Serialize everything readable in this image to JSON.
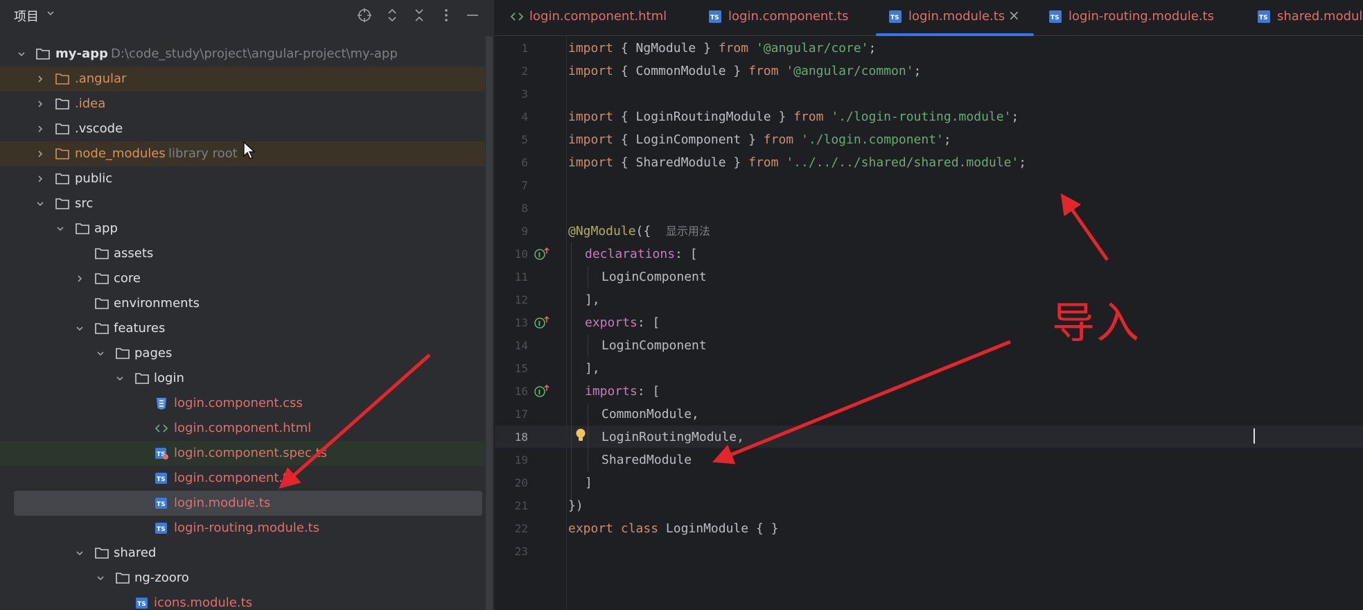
{
  "project": {
    "title": "项目",
    "header_icons": [
      "crosshair-icon",
      "expand-all-icon",
      "collapse-all-icon",
      "more-icon",
      "minimize-icon"
    ],
    "tree": [
      {
        "label": "my-app",
        "path": "D:\\code_study\\project\\angular-project\\my-app",
        "expanded": true
      },
      {
        "label": ".angular",
        "expanded": false
      },
      {
        "label": ".idea",
        "expanded": false
      },
      {
        "label": ".vscode",
        "expanded": false
      },
      {
        "label": "node_modules",
        "suffix": "library root",
        "expanded": false
      },
      {
        "label": "public",
        "expanded": false
      },
      {
        "label": "src",
        "expanded": true
      },
      {
        "label": "app",
        "expanded": true
      },
      {
        "label": "assets"
      },
      {
        "label": "core",
        "expanded": false
      },
      {
        "label": "environments"
      },
      {
        "label": "features",
        "expanded": true
      },
      {
        "label": "pages",
        "expanded": true
      },
      {
        "label": "login",
        "expanded": true
      },
      {
        "label": "login.component.css",
        "type": "css"
      },
      {
        "label": "login.component.html",
        "type": "html"
      },
      {
        "label": "login.component.spec.ts",
        "type": "spec"
      },
      {
        "label": "login.component.ts",
        "type": "ts"
      },
      {
        "label": "login.module.ts",
        "type": "ts",
        "selected": true
      },
      {
        "label": "login-routing.module.ts",
        "type": "ts"
      },
      {
        "label": "shared",
        "expanded": true
      },
      {
        "label": "ng-zooro",
        "expanded": true
      },
      {
        "label": "icons.module.ts",
        "type": "ts"
      }
    ]
  },
  "editor": {
    "tabs": [
      {
        "label": "login.component.html",
        "icon": "html-file-icon"
      },
      {
        "label": "login.component.ts",
        "icon": "ts-file-icon"
      },
      {
        "label": "login.module.ts",
        "icon": "ts-file-icon",
        "active": true,
        "close": "×"
      },
      {
        "label": "login-routing.module.ts",
        "icon": "ts-file-icon"
      },
      {
        "label": "shared.module",
        "icon": "ts-file-icon"
      }
    ],
    "line_numbers": [
      "1",
      "2",
      "3",
      "4",
      "5",
      "6",
      "7",
      "8",
      "9",
      "10",
      "11",
      "12",
      "13",
      "14",
      "15",
      "16",
      "17",
      "18",
      "19",
      "20",
      "21",
      "22",
      "23"
    ],
    "current_line": "18",
    "code": {
      "l1": {
        "kw1": "import",
        "mid": " { NgModule } ",
        "kw2": "from",
        "str": "'@angular/core'",
        "end": ";"
      },
      "l2": {
        "kw1": "import",
        "mid": " { CommonModule } ",
        "kw2": "from",
        "str": "'@angular/common'",
        "end": ";"
      },
      "l4": {
        "kw1": "import",
        "mid": " { LoginRoutingModule } ",
        "kw2": "from",
        "str": "'./login-routing.module'",
        "end": ";"
      },
      "l5": {
        "kw1": "import",
        "mid": " { LoginComponent } ",
        "kw2": "from",
        "str": "'./login.component'",
        "end": ";"
      },
      "l6": {
        "kw1": "import",
        "mid": " { SharedModule } ",
        "kw2": "from",
        "str": "'../../../shared/shared.module'",
        "end": ";"
      },
      "l9": {
        "ann": "@NgModule",
        "rest": "({",
        "hint": "显示用法"
      },
      "l10": {
        "prop": "declarations",
        "rest": ": ["
      },
      "l11": "LoginComponent",
      "l12": "],",
      "l13": {
        "prop": "exports",
        "rest": ": ["
      },
      "l14": "LoginComponent",
      "l15": "],",
      "l16": {
        "prop": "imports",
        "rest": ": ["
      },
      "l17": "CommonModule,",
      "l18": "LoginRoutingModule,",
      "l19": "SharedModule",
      "l20": "]",
      "l21": "})",
      "l22": {
        "kw1": "export",
        "kw2": "class",
        "rest": " LoginModule { }"
      }
    }
  },
  "annotation": {
    "text": "导入",
    "color": "#e3262b"
  },
  "colors": {
    "accent": "#3574f0",
    "arrow": "#e3262b",
    "keyword": "#cf8e6d",
    "string": "#6aab73"
  }
}
